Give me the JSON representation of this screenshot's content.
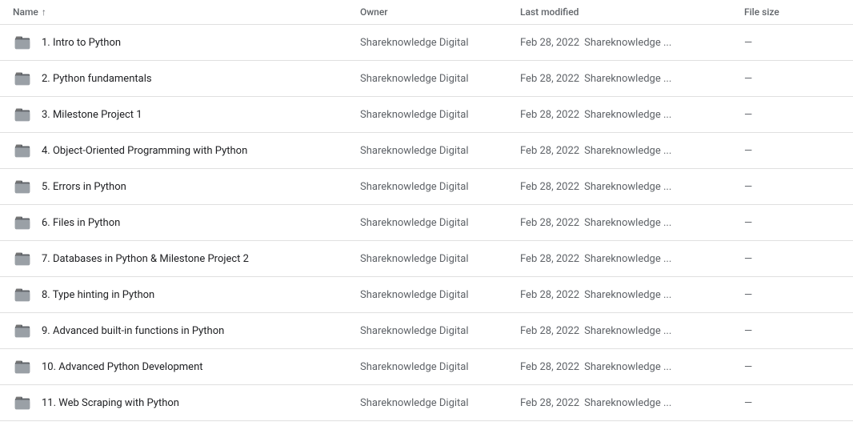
{
  "header": {
    "name_label": "Name",
    "owner_label": "Owner",
    "modified_label": "Last modified",
    "size_label": "File size"
  },
  "rows": [
    {
      "name": "1. Intro to Python",
      "owner": "Shareknowledge Digital",
      "date": "Feb 28, 2022",
      "modified_by": "Shareknowledge ...",
      "size": "—"
    },
    {
      "name": "2. Python fundamentals",
      "owner": "Shareknowledge Digital",
      "date": "Feb 28, 2022",
      "modified_by": "Shareknowledge ...",
      "size": "—"
    },
    {
      "name": "3. Milestone Project 1",
      "owner": "Shareknowledge Digital",
      "date": "Feb 28, 2022",
      "modified_by": "Shareknowledge ...",
      "size": "—"
    },
    {
      "name": "4. Object-Oriented Programming with Python",
      "owner": "Shareknowledge Digital",
      "date": "Feb 28, 2022",
      "modified_by": "Shareknowledge ...",
      "size": "—"
    },
    {
      "name": "5. Errors in Python",
      "owner": "Shareknowledge Digital",
      "date": "Feb 28, 2022",
      "modified_by": "Shareknowledge ...",
      "size": "—"
    },
    {
      "name": "6. Files in Python",
      "owner": "Shareknowledge Digital",
      "date": "Feb 28, 2022",
      "modified_by": "Shareknowledge ...",
      "size": "—"
    },
    {
      "name": "7. Databases in Python & Milestone Project 2",
      "owner": "Shareknowledge Digital",
      "date": "Feb 28, 2022",
      "modified_by": "Shareknowledge ...",
      "size": "—"
    },
    {
      "name": "8. Type hinting in Python",
      "owner": "Shareknowledge Digital",
      "date": "Feb 28, 2022",
      "modified_by": "Shareknowledge ...",
      "size": "—"
    },
    {
      "name": "9. Advanced built-in functions in Python",
      "owner": "Shareknowledge Digital",
      "date": "Feb 28, 2022",
      "modified_by": "Shareknowledge ...",
      "size": "—"
    },
    {
      "name": "10. Advanced Python Development",
      "owner": "Shareknowledge Digital",
      "date": "Feb 28, 2022",
      "modified_by": "Shareknowledge ...",
      "size": "—"
    },
    {
      "name": "11. Web Scraping with Python",
      "owner": "Shareknowledge Digital",
      "date": "Feb 28, 2022",
      "modified_by": "Shareknowledge ...",
      "size": "—"
    }
  ]
}
